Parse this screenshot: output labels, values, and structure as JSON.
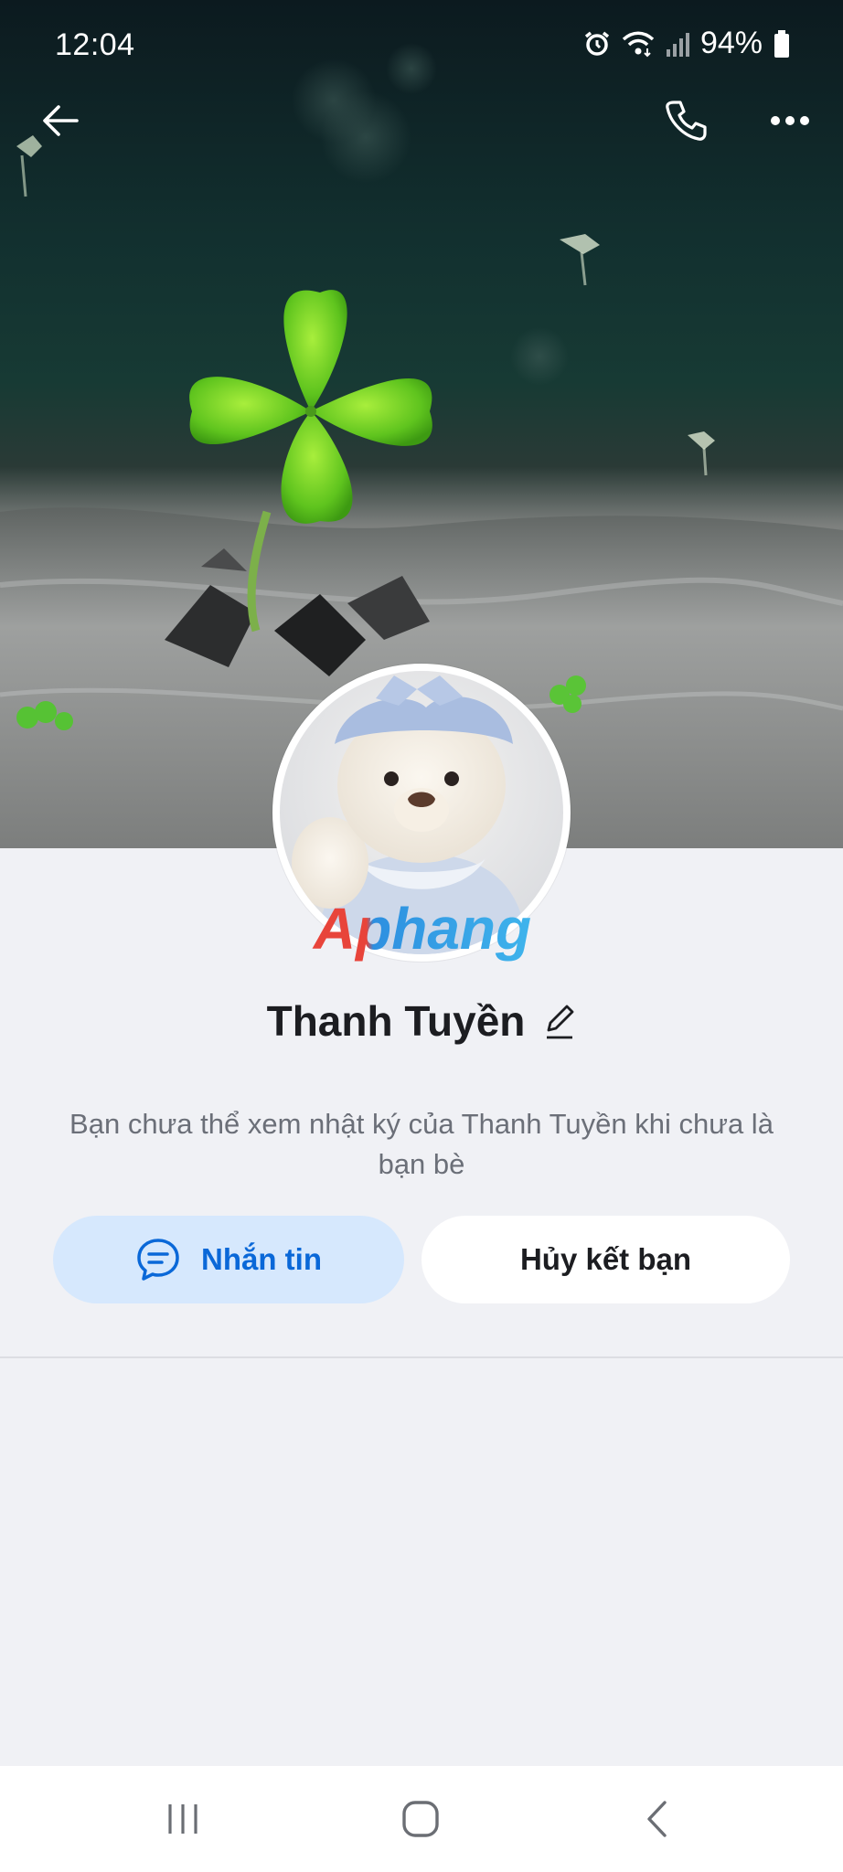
{
  "status_bar": {
    "time": "12:04",
    "battery_percent": "94%",
    "icons": [
      "alarm-icon",
      "wifi-icon",
      "signal-icon",
      "battery-icon"
    ]
  },
  "top_nav": {
    "icons": [
      "back-arrow-icon",
      "phone-icon",
      "more-icon"
    ]
  },
  "profile": {
    "name": "Thanh Tuyền",
    "privacy_note": "Bạn chưa thể xem nhật ký của Thanh Tuyền khi chưa là bạn bè",
    "watermark": "Aphang"
  },
  "actions": {
    "message_label": "Nhắn tin",
    "unfriend_label": "Hủy kết bạn"
  },
  "colors": {
    "accent": "#0a68d8",
    "message_button_bg": "#d6e8fd",
    "background": "#f0f1f5"
  },
  "system_nav": {
    "icons": [
      "recent-apps-icon",
      "home-icon",
      "back-icon"
    ]
  }
}
